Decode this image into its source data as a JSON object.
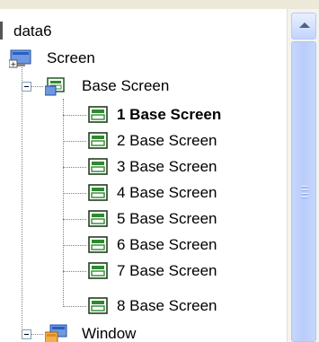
{
  "tree": {
    "root": {
      "label": "data6",
      "icon": "folder-icon"
    },
    "screen": {
      "label": "Screen",
      "icon": "screen-icon"
    },
    "base_screen_group": {
      "label": "Base Screen",
      "icon": "base-screen-icon",
      "expanded": true
    },
    "base_screens": [
      {
        "label": "1 Base Screen",
        "selected": true
      },
      {
        "label": "2 Base Screen",
        "selected": false
      },
      {
        "label": "3 Base Screen",
        "selected": false
      },
      {
        "label": "4 Base Screen",
        "selected": false
      },
      {
        "label": "5 Base Screen",
        "selected": false
      },
      {
        "label": "6 Base Screen",
        "selected": false
      },
      {
        "label": "7 Base Screen",
        "selected": false
      },
      {
        "label": "8 Base Screen",
        "selected": false
      }
    ],
    "window_group": {
      "label": "Window",
      "icon": "window-icon",
      "expanded": true
    }
  },
  "colors": {
    "screen_icon_blue": "#3a6ecf",
    "screen_icon_green": "#2f8a2f",
    "window_icon_orange": "#e08a1e"
  }
}
